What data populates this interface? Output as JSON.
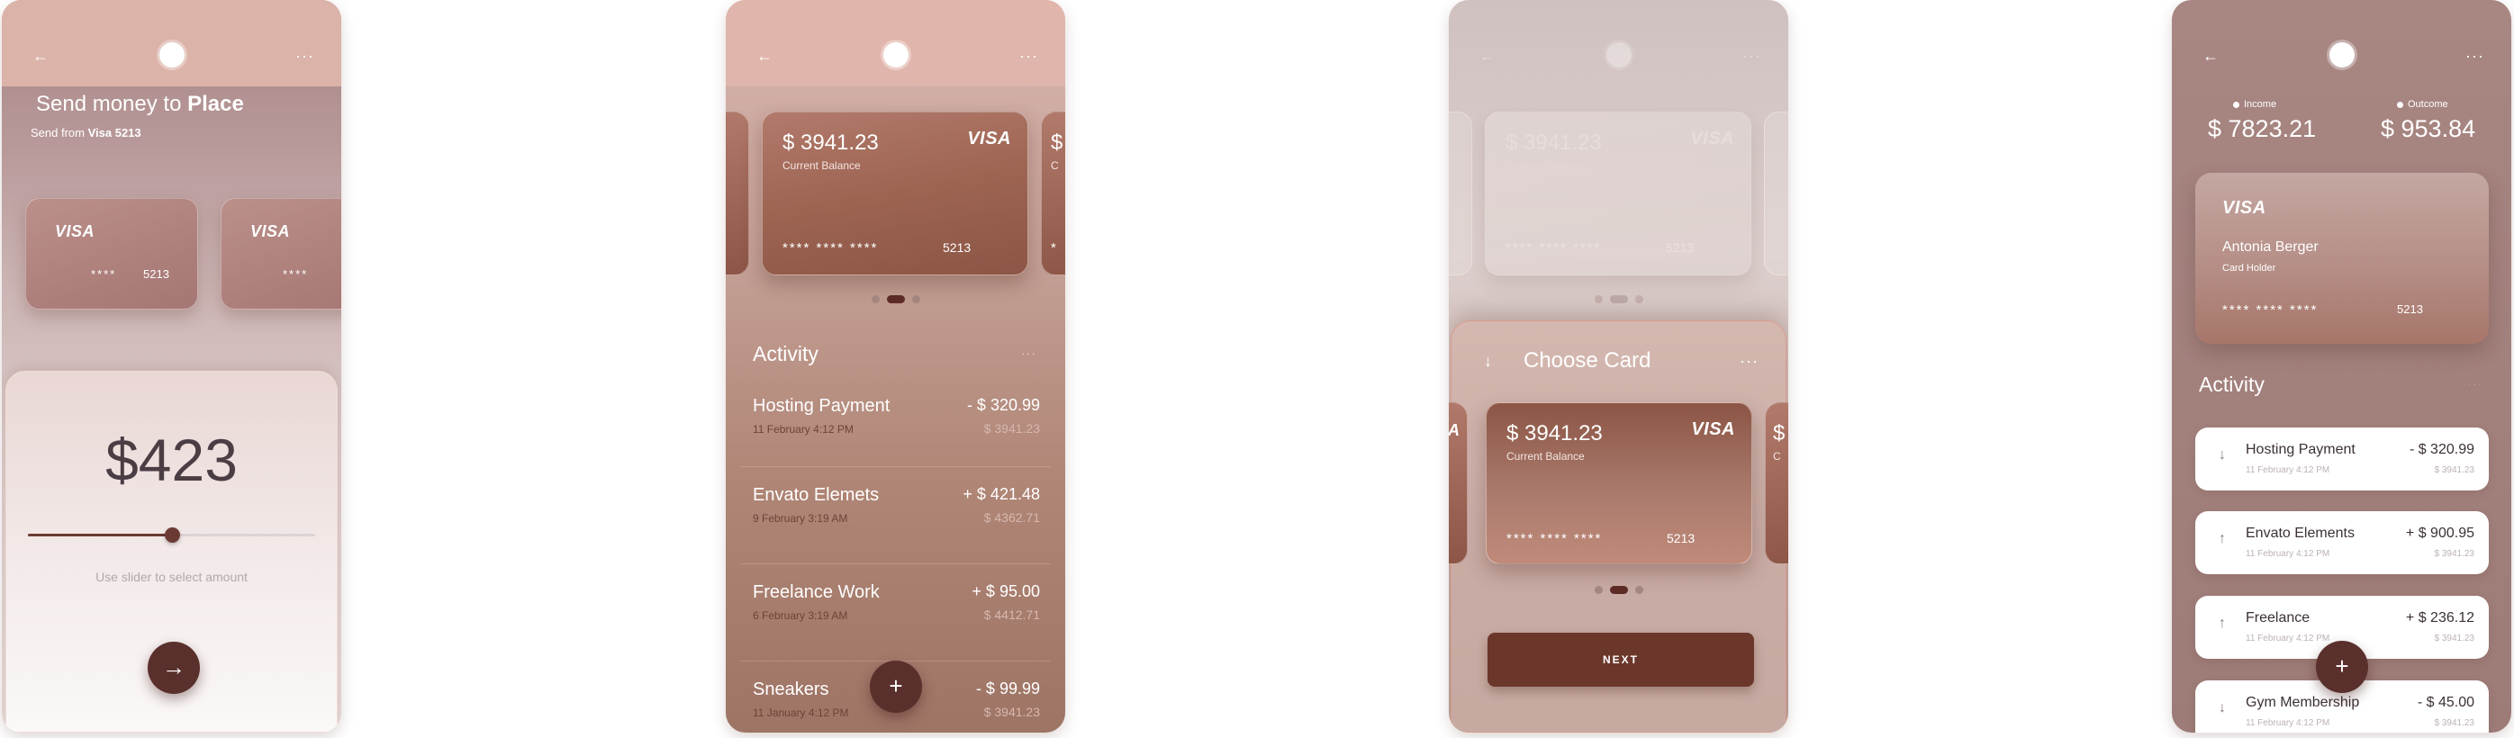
{
  "icons": {
    "back": "arrow-left-icon",
    "camera": "shutter-circle-icon",
    "more": "more-dots-icon",
    "down": "arrow-down-icon",
    "up": "arrow-up-icon",
    "add": "plus-icon",
    "forward": "arrow-right-icon"
  },
  "colors": {
    "accent": "#5a302c",
    "button": "#6c372b",
    "card": "#9d6452"
  },
  "glyphs": {
    "back": "←",
    "more": "···",
    "more_small": "···",
    "forward": "→",
    "plus": "+",
    "down": "↓",
    "up": "↑"
  },
  "screen1": {
    "title_prefix": "Send money to ",
    "title_bold": "Place",
    "sub_prefix": "Send from ",
    "sub_bold": "Visa 5213",
    "cards": [
      {
        "brand": "VISA",
        "mask": "****",
        "last4": "5213"
      },
      {
        "brand": "VISA",
        "mask": "****",
        "last4": ""
      }
    ],
    "amount": "$423",
    "slider_value": 0.5,
    "slider_hint": "Use slider to select amount"
  },
  "screen2": {
    "card": {
      "balance": "$ 3941.23",
      "caption": "Current Balance",
      "brand": "VISA",
      "mask": "****  ****  ****",
      "last4": "5213"
    },
    "peek_right_text": "$",
    "peek_right_sub": "C",
    "peek_right_mask": "*",
    "activity_title": "Activity",
    "transactions": [
      {
        "name": "Hosting Payment",
        "date": "11 February  4:12 PM",
        "amount": "- $ 320.99",
        "balance": "$ 3941.23"
      },
      {
        "name": "Envato Elemets",
        "date": "9 February  3:19 AM",
        "amount": "+ $ 421.48",
        "balance": "$ 4362.71"
      },
      {
        "name": "Freelance Work",
        "date": "6 February  3:19 AM",
        "amount": "+ $ 95.00",
        "balance": "$ 4412.71"
      },
      {
        "name": "Sneakers",
        "date": "11 January  4:12 PM",
        "amount": "- $ 99.99",
        "balance": "$ 3941.23"
      }
    ]
  },
  "screen3": {
    "bg_card": {
      "balance": "$ 3941.23",
      "caption": "Current Balance",
      "brand": "VISA",
      "mask": "****  ****  ****",
      "last4": "5213"
    },
    "sheet_title": "Choose Card",
    "card": {
      "balance": "$ 3941.23",
      "caption": "Current Balance",
      "brand": "VISA",
      "mask": "****  ****  ****",
      "last4": "5213"
    },
    "peek_left_text": "A",
    "peek_right_text": "$",
    "peek_right_sub": "C",
    "next_label": "NEXT"
  },
  "screen4": {
    "income_label": "Income",
    "outcome_label": "Outcome",
    "income_value": "$ 7823.21",
    "outcome_value": "$ 953.84",
    "card": {
      "brand": "VISA",
      "holder": "Antonia Berger",
      "role": "Card Holder",
      "mask": "****  ****  ****",
      "last4": "5213"
    },
    "activity_title": "Activity",
    "transactions": [
      {
        "direction": "down",
        "name": "Hosting Payment",
        "date": "11 February  4:12 PM",
        "amount": "- $ 320.99",
        "balance": "$ 3941.23"
      },
      {
        "direction": "up",
        "name": "Envato Elements",
        "date": "11 February  4:12 PM",
        "amount": "+ $ 900.95",
        "balance": "$ 3941.23"
      },
      {
        "direction": "up",
        "name": "Freelance",
        "date": "11 February  4:12 PM",
        "amount": "+ $ 236.12",
        "balance": "$ 3941.23"
      },
      {
        "direction": "down",
        "name": "Gym Membership",
        "date": "11 February  4:12 PM",
        "amount": "- $ 45.00",
        "balance": "$ 3941.23"
      }
    ]
  }
}
